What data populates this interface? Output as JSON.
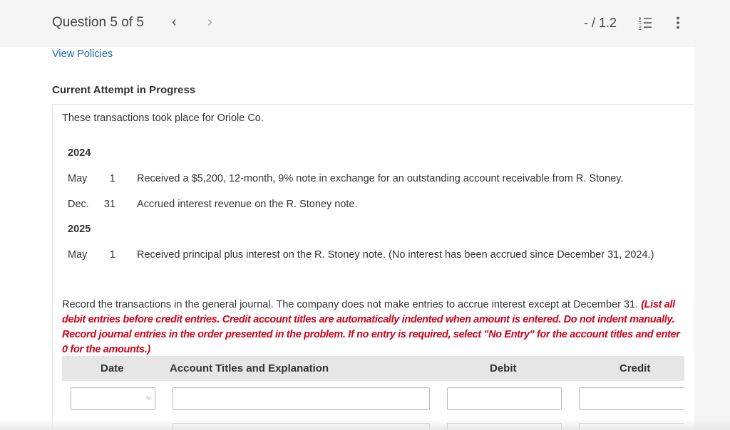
{
  "header": {
    "question_label": "Question 5 of 5",
    "prev_icon": "chevron-left-icon",
    "next_icon": "chevron-right-icon",
    "score": "- / 1.2",
    "list_icon": "numbered-list-icon",
    "more_icon": "more-vertical-icon"
  },
  "view_policies": "View Policies",
  "attempt_heading": "Current Attempt in Progress",
  "intro": "These transactions took place for Oriole Co.",
  "transactions": [
    {
      "year": "2024"
    },
    {
      "month": "May",
      "day": "1",
      "description": "Received a $5,200, 12-month, 9% note in exchange for an outstanding account receivable from R. Stoney."
    },
    {
      "month": "Dec.",
      "day": "31",
      "description": "Accrued interest revenue on the R. Stoney note."
    },
    {
      "year": "2025"
    },
    {
      "month": "May",
      "day": "1",
      "description": "Received principal plus interest on the R. Stoney note. (No interest has been accrued since December 31, 2024.)"
    }
  ],
  "instructions": {
    "plain": "Record the transactions in the general journal. The company does not make entries to accrue interest except at December 31.",
    "red": "(List all debit entries before credit entries. Credit account titles are automatically indented when amount is entered. Do not indent manually. Record journal entries in the order presented in the problem. If no entry is required, select \"No Entry\" for the account titles and enter 0 for the amounts.)"
  },
  "table": {
    "headers": [
      "Date",
      "Account Titles and Explanation",
      "Debit",
      "Credit"
    ],
    "date_select_value": "",
    "dropdown_icon": "chevron-down-icon"
  },
  "colors": {
    "link": "#1a66b2",
    "warning_text": "#d0021b",
    "table_header_bg": "#e6e6e6"
  }
}
